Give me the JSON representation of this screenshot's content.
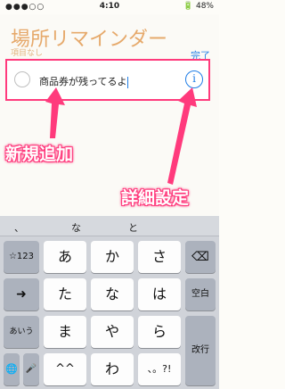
{
  "status": {
    "signal": "●●●○○",
    "time": "4:10",
    "battery": "48%"
  },
  "app": {
    "title": "場所リマインダー",
    "subtitle": "項目なし",
    "done": "完了"
  },
  "reminder": {
    "text": "商品券が残ってるよ",
    "info_label": "i"
  },
  "callouts": {
    "new_item": "新規追加",
    "details": "詳細設定"
  },
  "keyboard": {
    "suggestions": [
      "、",
      "な",
      "と"
    ],
    "rows": [
      [
        "☆123",
        "あ",
        "か",
        "さ",
        "⌫"
      ],
      [
        "➜",
        "た",
        "な",
        "は",
        "空白"
      ],
      [
        "あいう",
        "ま",
        "や",
        "ら",
        "改行"
      ],
      [
        "🌐",
        "🎤",
        "^^",
        "わ",
        "、。?!"
      ]
    ]
  },
  "colors": {
    "accent": "#ff3a7c",
    "link": "#1f7de6"
  }
}
